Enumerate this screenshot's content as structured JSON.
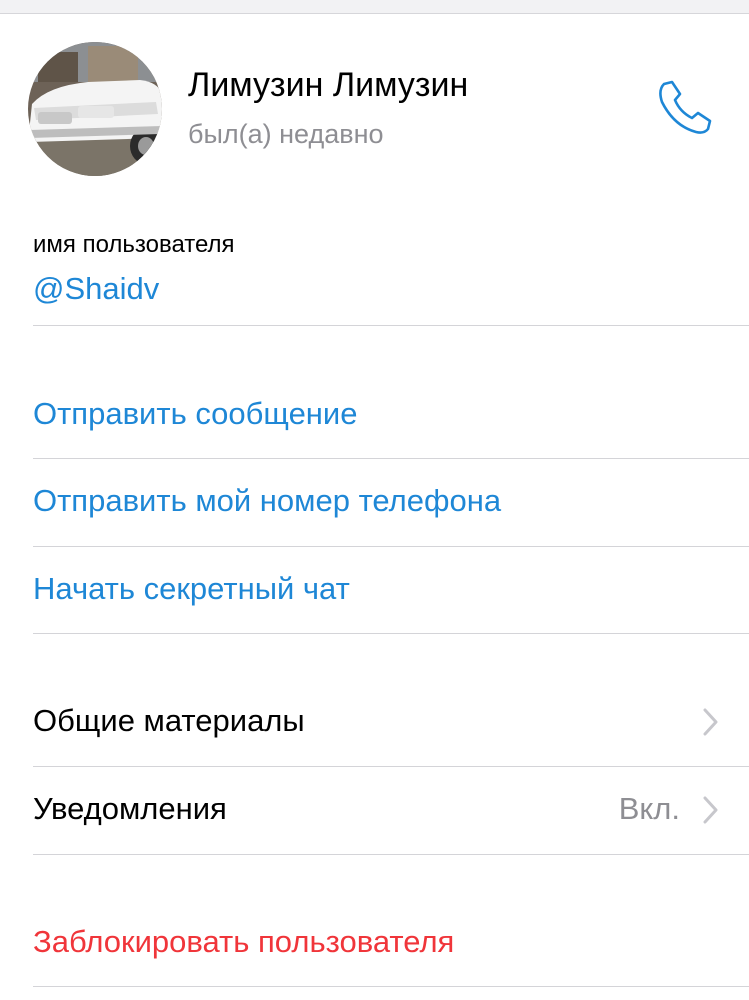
{
  "profile": {
    "name": "Лимузин Лимузин",
    "status": "был(а) недавно"
  },
  "username": {
    "caption": "имя пользователя",
    "value": "@Shaidv"
  },
  "actions": {
    "send_message": "Отправить сообщение",
    "send_phone": "Отправить мой номер телефона",
    "secret_chat": "Начать секретный чат"
  },
  "settings": {
    "shared_media": "Общие материалы",
    "notifications": "Уведомления",
    "notifications_value": "Вкл."
  },
  "block_user": "Заблокировать пользователя",
  "colors": {
    "accent": "#1e87d6",
    "destructive": "#f0353a",
    "secondary_text": "#8e8e93",
    "separator": "#d4d4d8"
  },
  "icons": [
    "phone-icon",
    "chevron-right-icon"
  ]
}
